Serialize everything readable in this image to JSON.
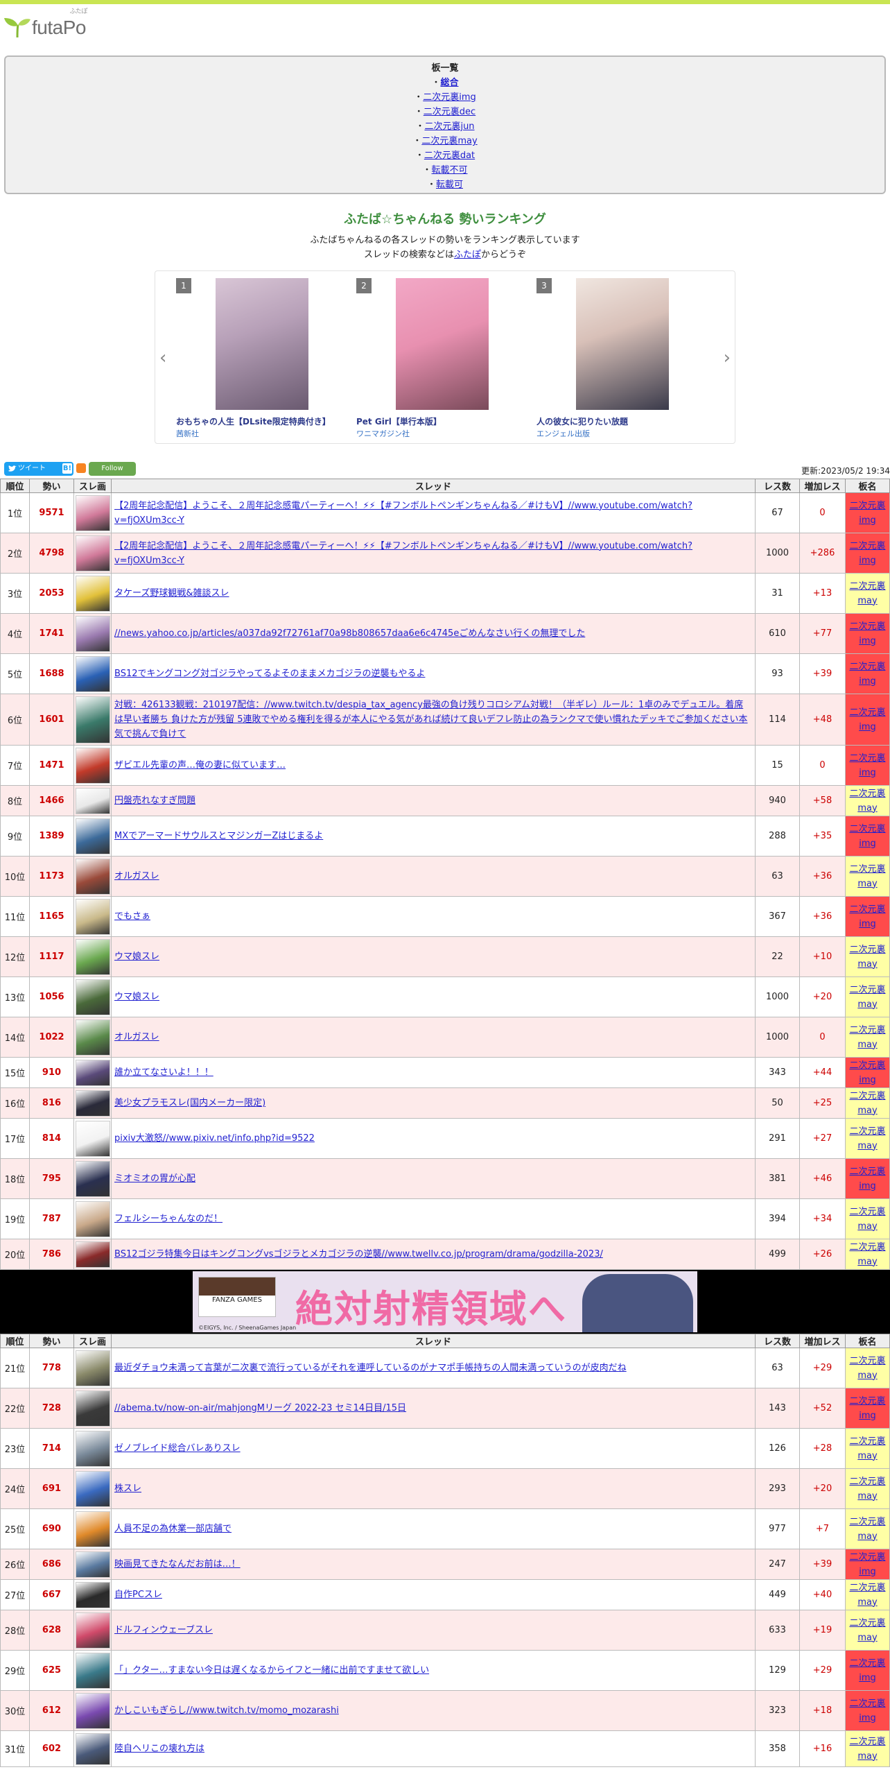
{
  "header": {
    "logo_text": "futaPo",
    "logo_ruby": "ふたぽ"
  },
  "boards": {
    "title": "板一覧",
    "items": [
      {
        "label": "総合",
        "selected": true
      },
      {
        "label": "二次元裏img"
      },
      {
        "label": "二次元裏dec"
      },
      {
        "label": "二次元裏jun"
      },
      {
        "label": "二次元裏may"
      },
      {
        "label": "二次元裏dat"
      },
      {
        "label": "転載不可"
      },
      {
        "label": "転載可"
      }
    ]
  },
  "ranking": {
    "title": "ふたば☆ちゃんねる 勢いランキング",
    "desc1": "ふたばちゃんねるの各スレッドの勢いをランキング表示しています",
    "desc2_pre": "スレッドの検索などは",
    "desc2_link": "ふたぽ",
    "desc2_post": "からどうぞ"
  },
  "carousel": [
    {
      "num": "1",
      "title": "おもちゃの人生【DLsite限定特典付き】",
      "publisher": "茜新社"
    },
    {
      "num": "2",
      "title": "Pet Girl【単行本版】",
      "publisher": "ワニマガジン社"
    },
    {
      "num": "3",
      "title": "人の彼女に犯りたい放題",
      "publisher": "エンジェル出版"
    }
  ],
  "social": {
    "tweet": "ツイート",
    "b": "B!",
    "follow": "Follow",
    "updated": "更新:2023/05/2 19:34"
  },
  "table_headers": [
    "順位",
    "勢い",
    "スレ画",
    "スレッド",
    "レス数",
    "増加レス",
    "板名"
  ],
  "board_names": {
    "img": [
      "二次元裏",
      "img"
    ],
    "may": [
      "二次元裏",
      "may"
    ]
  },
  "rows1": [
    {
      "rank": "1位",
      "mom": "9571",
      "title": "【2周年記念配信】ようこそ、２周年記念感電パーティーへ！⚡︎︎︎︎︎⚡【#フンボルトペンギンちゃんねる／#けもV】//www.youtube.com/watch?v=fjOXUm3cc-Y",
      "res": "67",
      "inc": "0",
      "board": "img",
      "h": 58,
      "col": "#d17a9a"
    },
    {
      "rank": "2位",
      "mom": "4798",
      "title": "【2周年記念配信】ようこそ、２周年記念感電パーティーへ！⚡︎︎︎︎︎⚡【#フンボルトペンギンちゃんねる／#けもV】//www.youtube.com/watch?v=fjOXUm3cc-Y",
      "res": "1000",
      "inc": "+286",
      "board": "img",
      "h": 58,
      "col": "#d17a9a"
    },
    {
      "rank": "3位",
      "mom": "2053",
      "title": "タケーズ野球観戦&雑談スレ",
      "res": "31",
      "inc": "+13",
      "board": "may",
      "h": 58,
      "col": "#e2c13a"
    },
    {
      "rank": "4位",
      "mom": "1741",
      "title": "//news.yahoo.co.jp/articles/a037da92f72761af70a98b808657daa6e6c4745eごめんなさい行くの無理でした",
      "res": "610",
      "inc": "+77",
      "board": "img",
      "h": 58,
      "col": "#9b7bb0"
    },
    {
      "rank": "5位",
      "mom": "1688",
      "title": "BS12でキングコング対ゴジラやってるよそのままメカゴジラの逆襲もやるよ",
      "res": "93",
      "inc": "+39",
      "board": "img",
      "h": 58,
      "col": "#2a61b5"
    },
    {
      "rank": "6位",
      "mom": "1601",
      "title": "対戦：426133観戦：210197配信：//www.twitch.tv/despia_tax_agency最強の負け残りコロシアム対戦！（半ギレ）ルール：1卓のみでデュエル。着席は早い者勝ち 負けた方が残留 5連敗でやめる権利を得るが本人にやる気があれば続けて良いデフレ防止の為ランクマで使い慣れたデッキでご参加ください本気で挑んで負けて",
      "res": "114",
      "inc": "+48",
      "board": "img",
      "h": 74,
      "col": "#3a7a6a"
    },
    {
      "rank": "7位",
      "mom": "1471",
      "title": "ザビエル先輩の声…俺の妻に似ています…",
      "res": "15",
      "inc": "0",
      "board": "img",
      "h": 58,
      "col": "#c23a2a"
    },
    {
      "rank": "8位",
      "mom": "1466",
      "title": "円盤売れなすぎ問題",
      "res": "940",
      "inc": "+58",
      "board": "may",
      "h": 44,
      "col": "#e8e8e8"
    },
    {
      "rank": "9位",
      "mom": "1389",
      "title": "MXでアーマードサウルスとマジンガーZはじまるよ",
      "res": "288",
      "inc": "+35",
      "board": "img",
      "h": 58,
      "col": "#3c6a9a"
    },
    {
      "rank": "10位",
      "mom": "1173",
      "title": "オルガスレ",
      "res": "63",
      "inc": "+36",
      "board": "may",
      "h": 58,
      "col": "#9a4a3a"
    },
    {
      "rank": "11位",
      "mom": "1165",
      "title": "でもさぁ",
      "res": "367",
      "inc": "+36",
      "board": "img",
      "h": 58,
      "col": "#c9b98a"
    },
    {
      "rank": "12位",
      "mom": "1117",
      "title": "ウマ娘スレ",
      "res": "22",
      "inc": "+10",
      "board": "may",
      "h": 58,
      "col": "#6aa84f"
    },
    {
      "rank": "13位",
      "mom": "1056",
      "title": "ウマ娘スレ",
      "res": "1000",
      "inc": "+20",
      "board": "may",
      "h": 58,
      "col": "#4a6a3a"
    },
    {
      "rank": "14位",
      "mom": "1022",
      "title": "オルガスレ",
      "res": "1000",
      "inc": "0",
      "board": "may",
      "h": 58,
      "col": "#5a8a4a"
    },
    {
      "rank": "15位",
      "mom": "910",
      "title": "誰か立てなさいよ！！！",
      "res": "343",
      "inc": "+44",
      "board": "img",
      "h": 44,
      "col": "#5a4a7a"
    },
    {
      "rank": "16位",
      "mom": "816",
      "title": "美少女プラモスレ(国内メーカー限定)",
      "res": "50",
      "inc": "+25",
      "board": "may",
      "h": 44,
      "col": "#2a2a3a"
    },
    {
      "rank": "17位",
      "mom": "814",
      "title": "pixiv大激怒//www.pixiv.net/info.php?id=9522",
      "res": "291",
      "inc": "+27",
      "board": "may",
      "h": 58,
      "col": "#f2f2f2"
    },
    {
      "rank": "18位",
      "mom": "795",
      "title": "ミオミオの胃が心配",
      "res": "381",
      "inc": "+46",
      "board": "img",
      "h": 58,
      "col": "#2a3050"
    },
    {
      "rank": "19位",
      "mom": "787",
      "title": "フェルシーちゃんなのだ！",
      "res": "394",
      "inc": "+34",
      "board": "may",
      "h": 58,
      "col": "#c9a98a"
    },
    {
      "rank": "20位",
      "mom": "786",
      "title": "BS12ゴジラ特集今日はキングコングvsゴジラとメカゴジラの逆襲//www.twellv.co.jp/program/drama/godzilla-2023/",
      "res": "499",
      "inc": "+26",
      "board": "may",
      "h": 44,
      "col": "#8a2a2a"
    }
  ],
  "ad": {
    "logo": "FANZA GAMES",
    "text": "絶対射精領域へ",
    "copy": "©EIGYS, Inc. / SheenaGames Japan"
  },
  "rows2": [
    {
      "rank": "21位",
      "mom": "778",
      "title": "最近ダチョウ未満って言葉が二次裏で流行っているがそれを連呼しているのがナマポ手帳持ちの人間未満っていうのが皮肉だね",
      "res": "63",
      "inc": "+29",
      "board": "may",
      "h": 58,
      "col": "#8a8a6a"
    },
    {
      "rank": "22位",
      "mom": "728",
      "title": "//abema.tv/now-on-air/mahjongMリーグ 2022-23 セミ14日目/15日",
      "res": "143",
      "inc": "+52",
      "board": "img",
      "h": 58,
      "col": "#3a3a3a"
    },
    {
      "rank": "23位",
      "mom": "714",
      "title": "ゼノブレイド総合バレありスレ",
      "res": "126",
      "inc": "+28",
      "board": "may",
      "h": 58,
      "col": "#7a8a9a"
    },
    {
      "rank": "24位",
      "mom": "691",
      "title": "株スレ",
      "res": "293",
      "inc": "+20",
      "board": "may",
      "h": 58,
      "col": "#3a6ac0"
    },
    {
      "rank": "25位",
      "mom": "690",
      "title": "人員不足の為休業一部店舗で",
      "res": "977",
      "inc": "+7",
      "board": "may",
      "h": 58,
      "col": "#e08a2a"
    },
    {
      "rank": "26位",
      "mom": "686",
      "title": "映画見てきたなんだお前は…！",
      "res": "247",
      "inc": "+39",
      "board": "img",
      "h": 44,
      "col": "#5a7aa0"
    },
    {
      "rank": "27位",
      "mom": "667",
      "title": "自作PCスレ",
      "res": "449",
      "inc": "+40",
      "board": "may",
      "h": 44,
      "col": "#2a2a2a"
    },
    {
      "rank": "28位",
      "mom": "628",
      "title": "ドルフィンウェーブスレ",
      "res": "633",
      "inc": "+19",
      "board": "may",
      "h": 58,
      "col": "#d04a6a"
    },
    {
      "rank": "29位",
      "mom": "625",
      "title": "「」クター…すまない今日は遅くなるからイフと一緒に出前ですませて欲しい",
      "res": "129",
      "inc": "+29",
      "board": "img",
      "h": 58,
      "col": "#3a7a8a"
    },
    {
      "rank": "30位",
      "mom": "612",
      "title": "かしこいもぎらし//www.twitch.tv/momo_mozarashi",
      "res": "323",
      "inc": "+18",
      "board": "img",
      "h": 58,
      "col": "#7a4ab0"
    },
    {
      "rank": "31位",
      "mom": "602",
      "title": "陸自ヘリこの壊れ方は",
      "res": "358",
      "inc": "+16",
      "board": "may",
      "h": 52,
      "col": "#4a5a7a"
    }
  ]
}
